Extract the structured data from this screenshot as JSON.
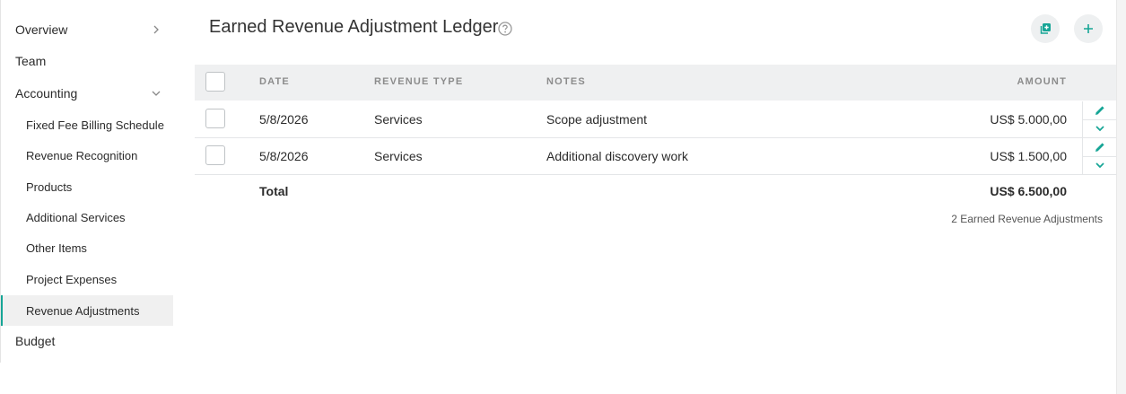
{
  "sidebar": {
    "items": [
      {
        "label": "Overview",
        "level": "top",
        "chevron": "right"
      },
      {
        "label": "Team",
        "level": "top"
      },
      {
        "label": "Accounting",
        "level": "top",
        "chevron": "down"
      },
      {
        "label": "Fixed Fee Billing Schedule",
        "level": "sub"
      },
      {
        "label": "Revenue Recognition",
        "level": "sub"
      },
      {
        "label": "Products",
        "level": "sub"
      },
      {
        "label": "Additional Services",
        "level": "sub"
      },
      {
        "label": "Other Items",
        "level": "sub"
      },
      {
        "label": "Project Expenses",
        "level": "sub"
      },
      {
        "label": "Revenue Adjustments",
        "level": "sub",
        "active": true
      },
      {
        "label": "Budget",
        "level": "top"
      }
    ]
  },
  "header": {
    "title": "Earned Revenue Adjustment Ledger",
    "help_icon": "question-circle-icon",
    "actions": [
      "copy-plus-icon",
      "plus-icon"
    ]
  },
  "table": {
    "columns": [
      "DATE",
      "REVENUE TYPE",
      "NOTES",
      "AMOUNT"
    ],
    "rows": [
      {
        "date": "5/8/2026",
        "type": "Services",
        "notes": "Scope adjustment",
        "amount": "US$ 5.000,00"
      },
      {
        "date": "5/8/2026",
        "type": "Services",
        "notes": "Additional discovery work",
        "amount": "US$ 1.500,00"
      }
    ],
    "total_label": "Total",
    "total_value": "US$ 6.500,00",
    "count_text": "2 Earned Revenue Adjustments"
  },
  "colors": {
    "accent": "#16a596",
    "header_bg": "#eff0f1"
  }
}
